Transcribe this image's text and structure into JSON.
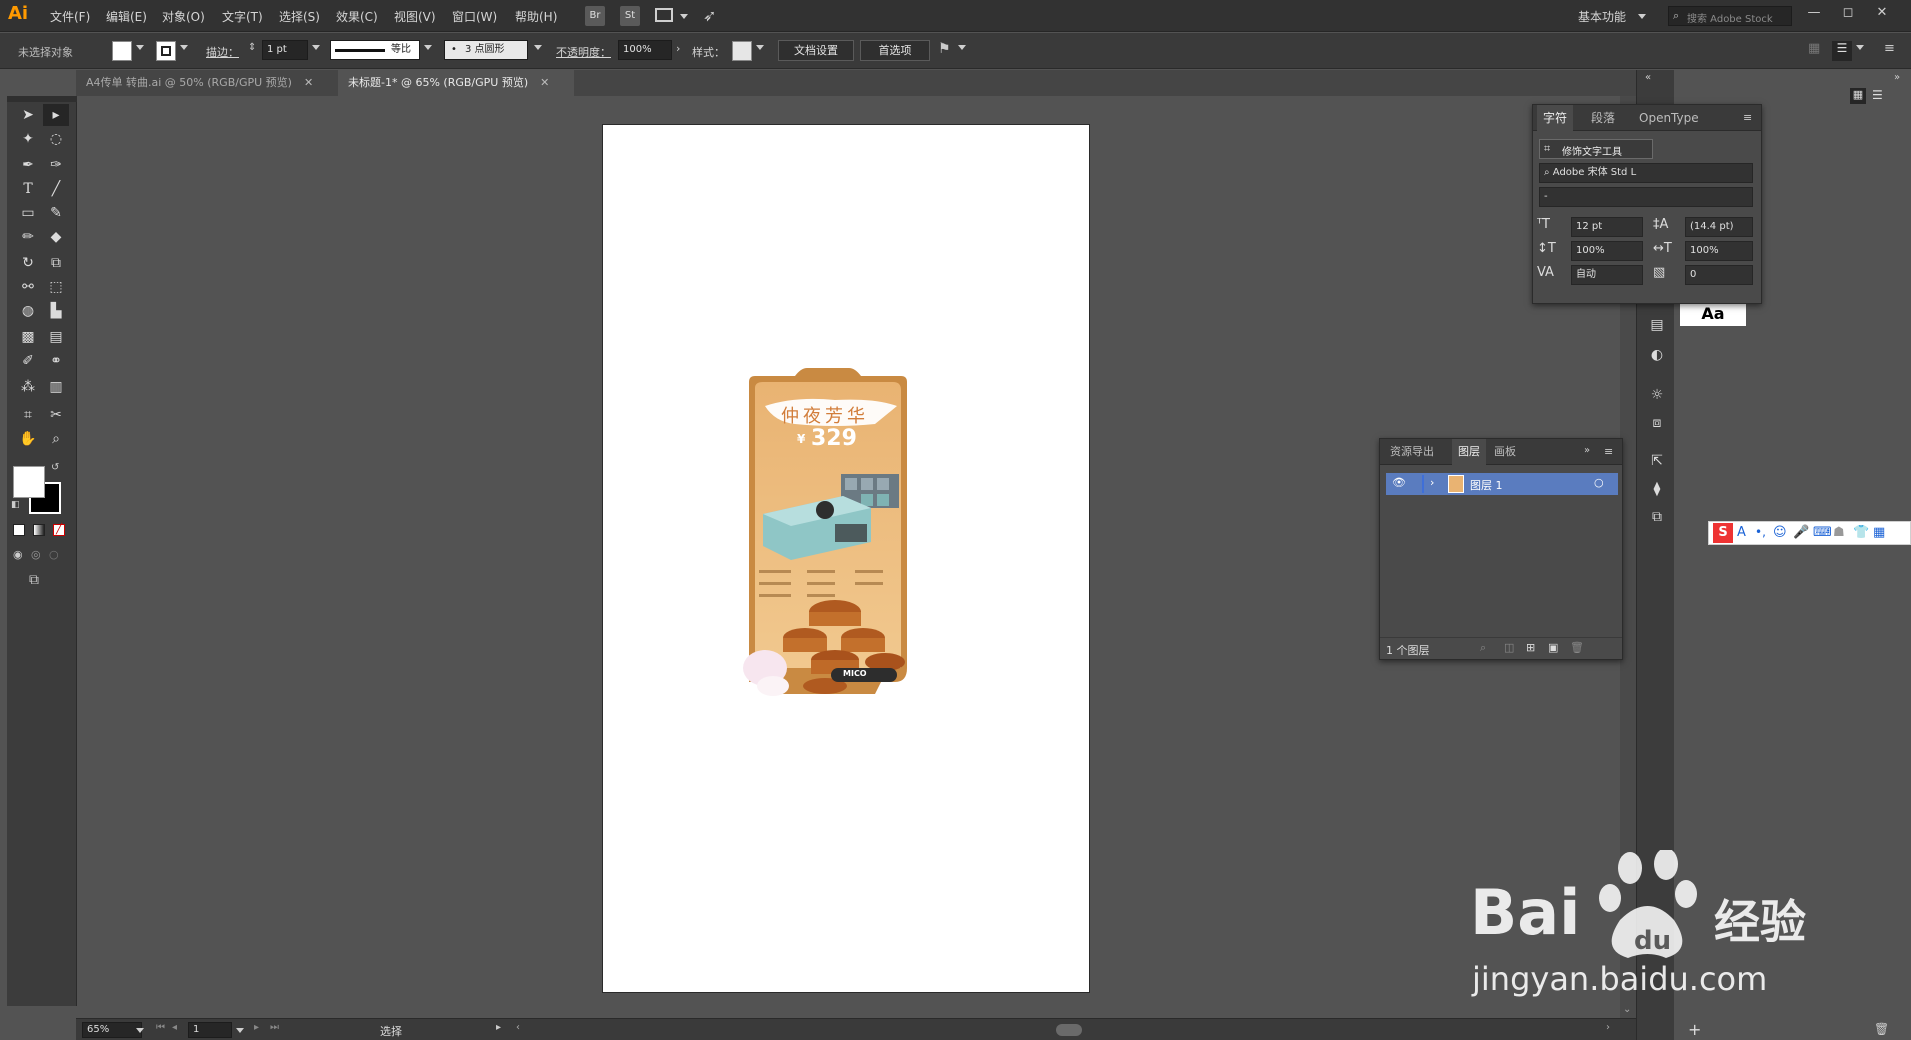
{
  "app": {
    "logo": "Ai",
    "menus": [
      "文件(F)",
      "编辑(E)",
      "对象(O)",
      "文字(T)",
      "选择(S)",
      "效果(C)",
      "视图(V)",
      "窗口(W)",
      "帮助(H)"
    ],
    "toolbar_icons": [
      "Br",
      "St"
    ],
    "workspace": "基本功能",
    "search_placeholder": "搜索 Adobe Stock"
  },
  "control_bar": {
    "selection_status": "未选择对象",
    "stroke_label": "描边：",
    "stroke_value": "1 pt",
    "stroke_profile": "等比",
    "brush": "3 点圆形",
    "opacity_label": "不透明度：",
    "opacity_value": "100%",
    "style_label": "样式：",
    "doc_setup_button": "文档设置",
    "prefs_button": "首选项"
  },
  "tabs": [
    {
      "label": "A4传单 转曲.ai @ 50% (RGB/GPU 预览)",
      "active": false
    },
    {
      "label": "未标题-1* @ 65% (RGB/GPU 预览)",
      "active": true
    }
  ],
  "poster": {
    "title": "仲夜芳华",
    "price_symbol": "¥",
    "price": "329",
    "brand": "MICO"
  },
  "status_bar": {
    "zoom": "65%",
    "page": "1",
    "tool": "选择"
  },
  "character_panel": {
    "tabs": [
      "字符",
      "段落",
      "OpenType"
    ],
    "touch_type_button": "修饰文字工具",
    "font_family": "Adobe 宋体 Std L",
    "font_style": "-",
    "font_size": "12 pt",
    "leading": "(14.4 pt)",
    "vertical_scale": "100%",
    "horizontal_scale": "100%",
    "kerning": "自动",
    "tracking": "0"
  },
  "layers_panel": {
    "tabs": [
      "资源导出",
      "图层",
      "画板"
    ],
    "layer_name": "图层 1",
    "footer_count": "1 个图层"
  },
  "watermark": {
    "brand": "Bai",
    "suffix": "经验",
    "url": "jingyan.baidu.com"
  }
}
